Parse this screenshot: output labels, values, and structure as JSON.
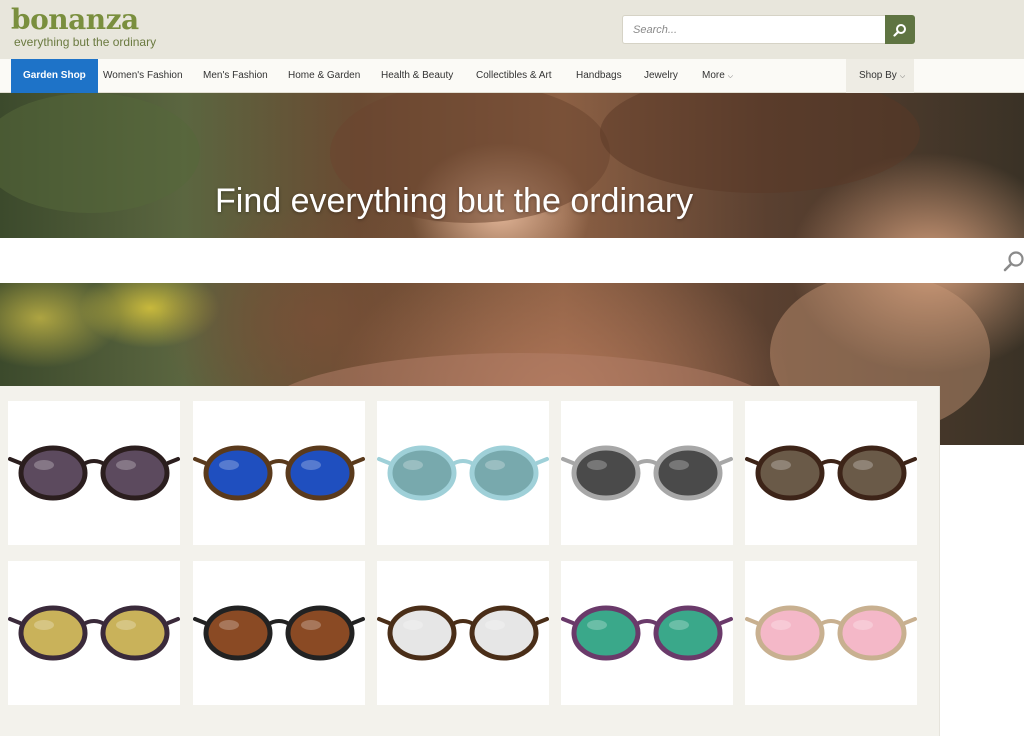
{
  "brand": {
    "name": "bonanza",
    "tagline": "everything but the ordinary"
  },
  "search": {
    "placeholder": "Search..."
  },
  "nav": {
    "items": [
      {
        "label": "Garden Shop"
      },
      {
        "label": "Women's Fashion"
      },
      {
        "label": "Men's Fashion"
      },
      {
        "label": "Home & Garden"
      },
      {
        "label": "Health & Beauty"
      },
      {
        "label": "Collectibles & Art"
      },
      {
        "label": "Handbags"
      },
      {
        "label": "Jewelry"
      },
      {
        "label": "More"
      }
    ],
    "shop_by": "Shop By"
  },
  "hero": {
    "title": "Find everything but the ordinary"
  },
  "products": [
    {
      "name": "cat-eye tortoise sunglasses",
      "lens": "#5c4a5e",
      "frame": "#2b1e1e"
    },
    {
      "name": "blue mirrored clubmaster sunglasses",
      "lens": "#1f4fbf",
      "frame": "#5a3a1c"
    },
    {
      "name": "teal aviator sunglasses",
      "lens": "#78a9ad",
      "frame": "#9fd0d8"
    },
    {
      "name": "grey wrap sport sunglasses",
      "lens": "#4a4a4a",
      "frame": "#a7a7a7"
    },
    {
      "name": "tortoise cat-eye sunglasses",
      "lens": "#6a5a48",
      "frame": "#3d2418"
    },
    {
      "name": "yellow lens rectangular sunglasses",
      "lens": "#c9b25a",
      "frame": "#3a2a3a"
    },
    {
      "name": "brown gradient wrap sunglasses",
      "lens": "#8a4a24",
      "frame": "#222222"
    },
    {
      "name": "silver mirrored clubmaster sunglasses",
      "lens": "#e6e6e6",
      "frame": "#4a2e18"
    },
    {
      "name": "rainbow mirrored round sunglasses",
      "lens": "#3aa88a",
      "frame": "#6a3a6a"
    },
    {
      "name": "pink mirrored cat-eye sunglasses",
      "lens": "#f4b8c8",
      "frame": "#c8b090"
    }
  ],
  "colors": {
    "brand_green": "#7a8f3e",
    "active_nav": "#1e73c8",
    "search_button": "#5f7442"
  }
}
